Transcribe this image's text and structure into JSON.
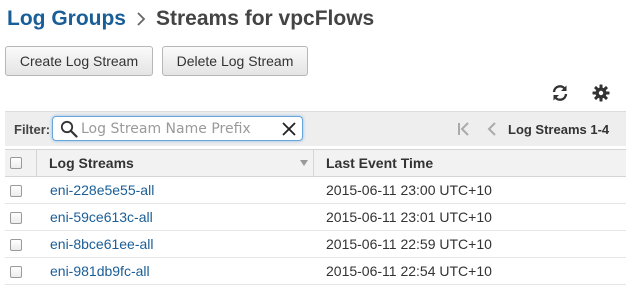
{
  "breadcrumb": {
    "parent": "Log Groups",
    "separator_icon": "chevron-right-icon",
    "current": "Streams for vpcFlows"
  },
  "toolbar": {
    "create_label": "Create Log Stream",
    "delete_label": "Delete Log Stream",
    "refresh_icon": "refresh-icon",
    "settings_icon": "gear-icon"
  },
  "filter": {
    "label": "Filter:",
    "value": "",
    "placeholder": "Log Stream Name Prefix"
  },
  "pager": {
    "label": "Log Streams 1-4"
  },
  "table": {
    "columns": [
      "Log Streams",
      "Last Event Time"
    ],
    "rows": [
      {
        "name": "eni-228e5e55-all",
        "last_event": "2015-06-11 23:00 UTC+10"
      },
      {
        "name": "eni-59ce613c-all",
        "last_event": "2015-06-11 23:01 UTC+10"
      },
      {
        "name": "eni-8bce61ee-all",
        "last_event": "2015-06-11 22:59 UTC+10"
      },
      {
        "name": "eni-981db9fc-all",
        "last_event": "2015-06-11 22:54 UTC+10"
      }
    ]
  },
  "colors": {
    "link": "#1a5e97",
    "header_bg": "#f2f2f2",
    "filter_bg": "#eeeeee",
    "focus_border": "#69a6dc"
  }
}
